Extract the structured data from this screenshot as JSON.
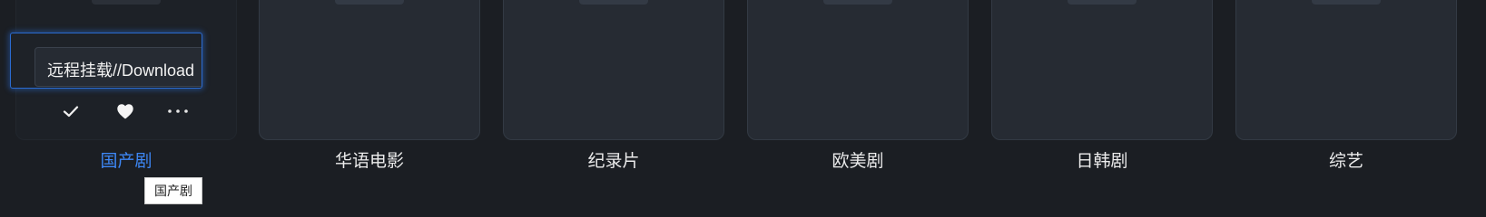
{
  "libraries": [
    {
      "label": "国产剧",
      "active": true
    },
    {
      "label": "华语电影",
      "active": false
    },
    {
      "label": "纪录片",
      "active": false
    },
    {
      "label": "欧美剧",
      "active": false
    },
    {
      "label": "日韩剧",
      "active": false
    },
    {
      "label": "综艺",
      "active": false
    }
  ],
  "hover_card": {
    "name_text": "远程挂载//Download",
    "actions": [
      {
        "icon": "check-icon"
      },
      {
        "icon": "heart-icon"
      },
      {
        "icon": "more-horizontal-icon"
      }
    ]
  },
  "tooltip": {
    "text": "国产剧"
  },
  "colors": {
    "background": "#1b1e23",
    "card": "#262b33",
    "accent": "#3d87f5"
  }
}
